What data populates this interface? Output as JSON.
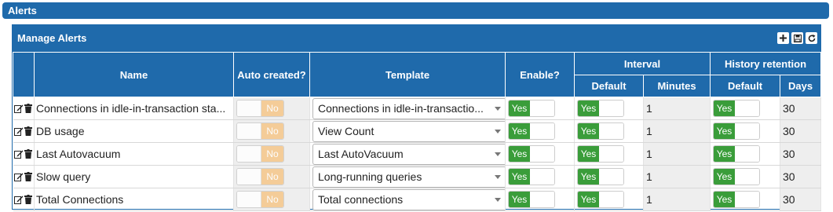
{
  "page": {
    "title": "Alerts"
  },
  "panel": {
    "title": "Manage Alerts",
    "toolbar": [
      "add-icon",
      "save-icon",
      "refresh-icon"
    ]
  },
  "columns": {
    "name": "Name",
    "auto_created": "Auto created?",
    "template": "Template",
    "enable": "Enable?",
    "interval": "Interval",
    "interval_default": "Default",
    "interval_minutes": "Minutes",
    "history": "History retention",
    "history_default": "Default",
    "history_days": "Days"
  },
  "toggle_labels": {
    "yes": "Yes",
    "no": "No"
  },
  "rows": [
    {
      "name": "Connections in idle-in-transaction sta...",
      "auto_created": "No",
      "template": "Connections in idle-in-transactio...",
      "enable": "Yes",
      "interval_default": "Yes",
      "minutes": "1",
      "history_default": "Yes",
      "days": "30"
    },
    {
      "name": "DB usage",
      "auto_created": "No",
      "template": "View Count",
      "enable": "Yes",
      "interval_default": "Yes",
      "minutes": "1",
      "history_default": "Yes",
      "days": "30"
    },
    {
      "name": "Last Autovacuum",
      "auto_created": "No",
      "template": "Last AutoVacuum",
      "enable": "Yes",
      "interval_default": "Yes",
      "minutes": "1",
      "history_default": "Yes",
      "days": "30"
    },
    {
      "name": "Slow query",
      "auto_created": "No",
      "template": "Long-running queries",
      "enable": "Yes",
      "interval_default": "Yes",
      "minutes": "1",
      "history_default": "Yes",
      "days": "30"
    },
    {
      "name": "Total Connections",
      "auto_created": "No",
      "template": "Total connections",
      "enable": "Yes",
      "interval_default": "Yes",
      "minutes": "1",
      "history_default": "Yes",
      "days": "30"
    }
  ],
  "colors": {
    "header": "#1f6aab",
    "yes": "#3a9d3a",
    "no": "#f6c78a",
    "readonly_bg": "#eeeeee"
  }
}
